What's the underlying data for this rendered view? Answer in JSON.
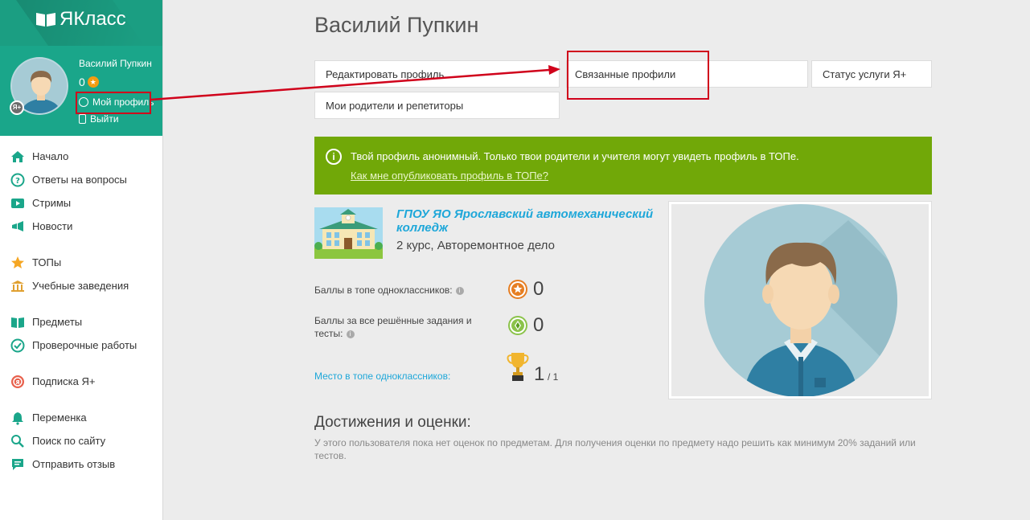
{
  "app": {
    "logo_text": "ЯКласс"
  },
  "user": {
    "name": "Василий Пупкин",
    "score": "0",
    "profile_link": "Мой профиль",
    "logout_link": "Выйти",
    "badge": "Я+"
  },
  "nav": {
    "groups": [
      [
        {
          "label": "Начало",
          "icon": "home-icon"
        },
        {
          "label": "Ответы на вопросы",
          "icon": "question-icon"
        },
        {
          "label": "Стримы",
          "icon": "stream-icon"
        },
        {
          "label": "Новости",
          "icon": "news-icon"
        }
      ],
      [
        {
          "label": "ТОПы",
          "icon": "star-icon"
        },
        {
          "label": "Учебные заведения",
          "icon": "institution-icon"
        }
      ],
      [
        {
          "label": "Предметы",
          "icon": "book-icon"
        },
        {
          "label": "Проверочные работы",
          "icon": "check-icon"
        }
      ],
      [
        {
          "label": "Подписка Я+",
          "icon": "subscription-icon"
        }
      ],
      [
        {
          "label": "Переменка",
          "icon": "bell-icon"
        },
        {
          "label": "Поиск по сайту",
          "icon": "search-icon"
        },
        {
          "label": "Отправить отзыв",
          "icon": "feedback-icon"
        }
      ]
    ]
  },
  "main": {
    "title": "Василий Пупкин",
    "tabs": {
      "edit": "Редактировать профиль",
      "linked": "Связанные профили",
      "status": "Статус услуги Я+",
      "parents": "Мои родители и репетиторы"
    },
    "notice": {
      "text": "Твой профиль анонимный. Только твои родители и учителя могут увидеть профиль в ТОПе.",
      "link": "Как мне опубликовать профиль в ТОПе?"
    },
    "school": {
      "name": "ГПОУ ЯО Ярославский автомеханический колледж",
      "course": "2 курс, Авторемонтное дело"
    },
    "stats": {
      "top_label": "Баллы в топе одноклассников:",
      "top_value": "0",
      "tasks_label": "Баллы за все решённые задания и тесты:",
      "tasks_value": "0",
      "rank_label": "Место в топе одноклассников:",
      "rank_value": "1",
      "rank_total": "/ 1"
    },
    "achievements": {
      "title": "Достижения и оценки:",
      "text": "У этого пользователя пока нет оценок по предметам. Для получения оценки по предмету надо решить как минимум 20% заданий или тестов."
    }
  },
  "colors": {
    "brand": "#1aa68a",
    "notice": "#71a808",
    "link": "#1ea7d9",
    "highlight": "#d0021b"
  }
}
